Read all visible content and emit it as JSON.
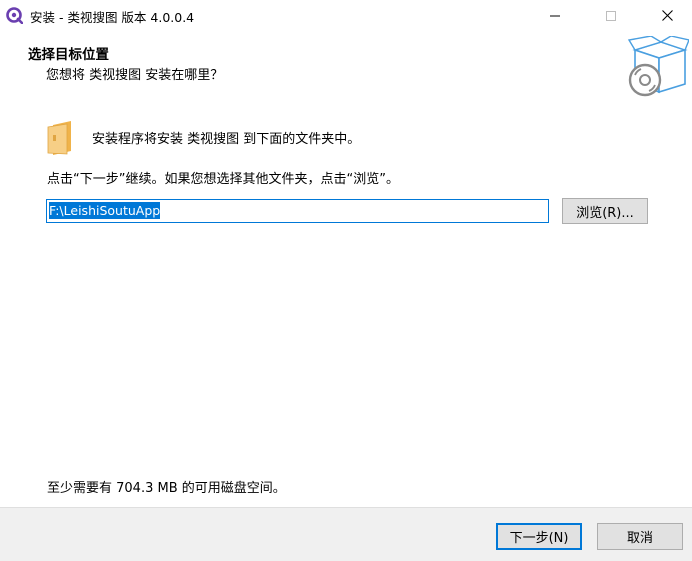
{
  "window": {
    "title": "安装 - 类视搜图 版本 4.0.0.4",
    "controls": {
      "minimize": "minimize-icon",
      "maximize": "maximize-icon",
      "close": "close-icon"
    }
  },
  "header": {
    "title": "选择目标位置",
    "subtitle": "您想将 类视搜图 安装在哪里？"
  },
  "body": {
    "install_message": "安装程序将安装 类视搜图 到下面的文件夹中。",
    "instruction": "点击“下一步”继续。如果您想选择其他文件夹，点击“浏览”。",
    "path_value": "F:\\LeishiSoutuApp",
    "browse_label": "浏览(R)...",
    "space_note": "至少需要有 704.3 MB 的可用磁盘空间。"
  },
  "footer": {
    "next_label": "下一步(N)",
    "cancel_label": "取消"
  },
  "colors": {
    "accent": "#0078d7",
    "app_icon": "#6a3fb0",
    "folder": "#f4c26b",
    "graphic": "#4a9fe0",
    "footer_bg": "#f0f0f0"
  }
}
